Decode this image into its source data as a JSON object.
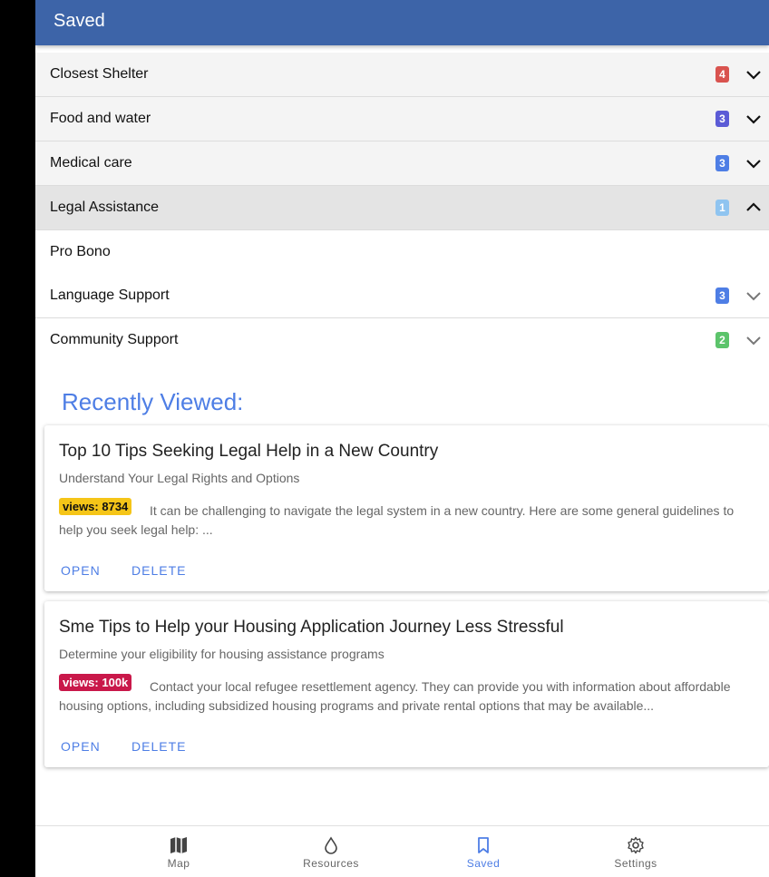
{
  "header": {
    "title": "Saved"
  },
  "categories": [
    {
      "label": "Closest Shelter",
      "count": "4",
      "color": "#d9534f",
      "expanded": false
    },
    {
      "label": "Food and water",
      "count": "3",
      "color": "#5b5bd6",
      "expanded": false
    },
    {
      "label": "Medical care",
      "count": "3",
      "color": "#4e7ee5",
      "expanded": false
    },
    {
      "label": "Legal Assistance",
      "count": "1",
      "color": "#8fc4f0",
      "expanded": true
    },
    {
      "label": "Language Support",
      "count": "3",
      "color": "#4e7ee5",
      "expanded": false
    },
    {
      "label": "Community Support",
      "count": "2",
      "color": "#5cc46b",
      "expanded": false
    }
  ],
  "subitem": {
    "label": "Pro Bono"
  },
  "recent": {
    "title": "Recently Viewed:",
    "cards": [
      {
        "title": "Top 10 Tips Seeking Legal Help in a New Country",
        "subtitle": "Understand Your Legal Rights and Options",
        "views": "views: 8734",
        "views_bg": "#f5c518",
        "views_color": "#111111",
        "body": "It can be challenging to navigate the legal system in a new country. Here are some general guidelines to help you seek legal help: ...",
        "open": "OPEN",
        "delete": "DELETE"
      },
      {
        "title": "Sme Tips to Help your Housing Application Journey Less Stressful",
        "subtitle": "Determine your eligibility for housing assistance programs",
        "views": "views: 100k",
        "views_bg": "#c9184a",
        "views_color": "#ffffff",
        "body": "Contact your local refugee resettlement agency. They can provide you with information about affordable housing options, including subsidized housing programs and private rental options that may be available...",
        "open": "OPEN",
        "delete": "DELETE"
      }
    ]
  },
  "nav": [
    {
      "label": "Map",
      "icon": "map-icon",
      "active": false
    },
    {
      "label": "Resources",
      "icon": "drop-icon",
      "active": false
    },
    {
      "label": "Saved",
      "icon": "bookmark-icon",
      "active": true
    },
    {
      "label": "Settings",
      "icon": "gear-icon",
      "active": false
    }
  ]
}
